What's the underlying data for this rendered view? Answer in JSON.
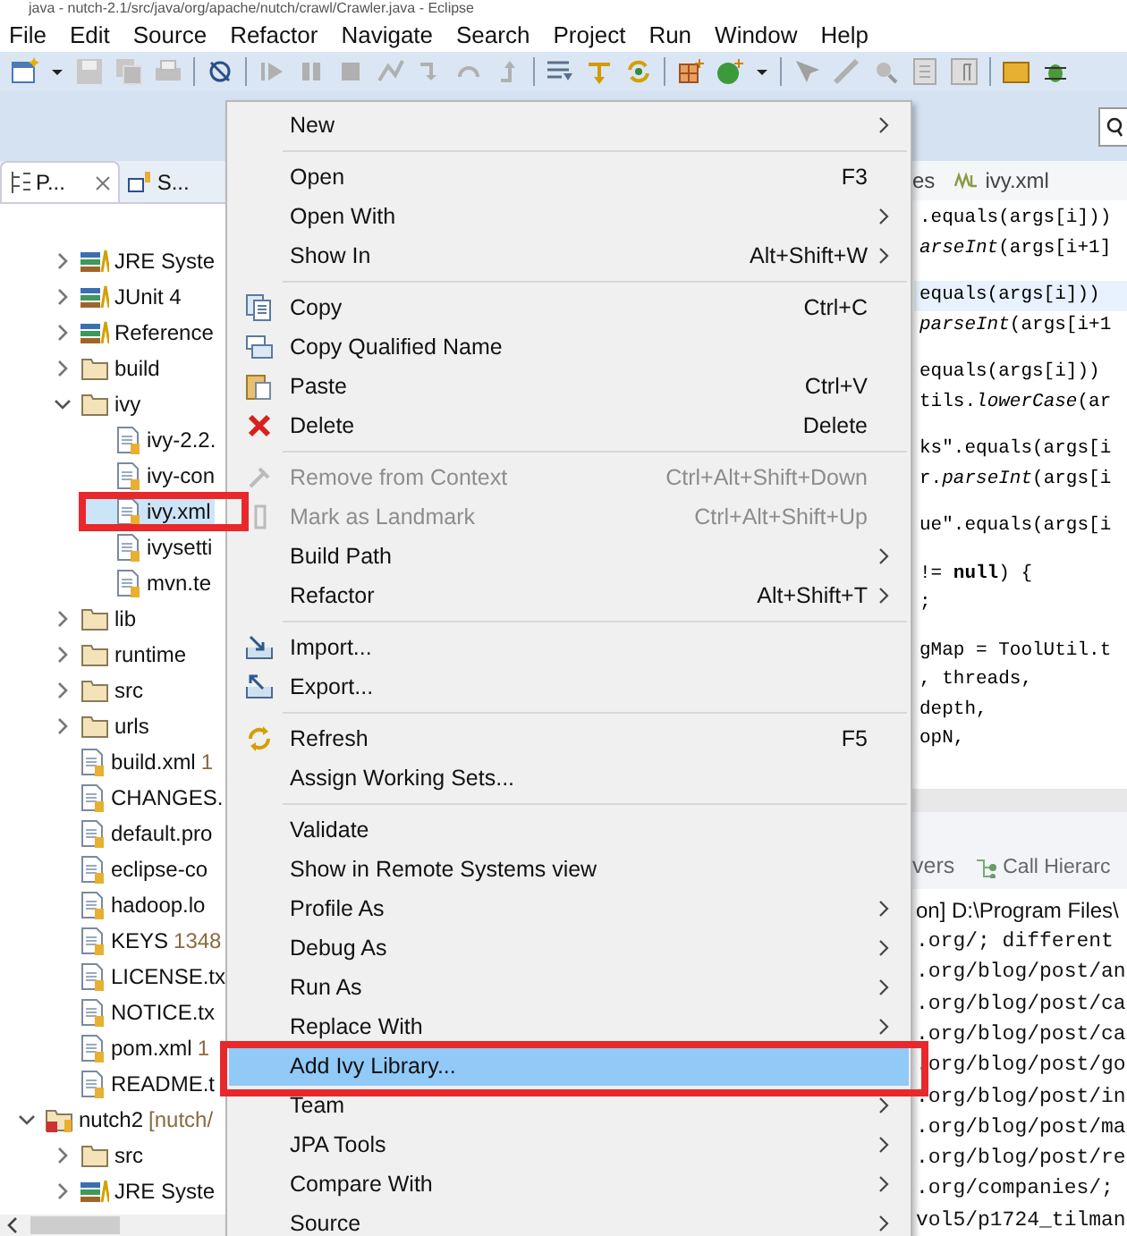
{
  "window": {
    "title": "java - nutch-2.1/src/java/org/apache/nutch/crawl/Crawler.java - Eclipse"
  },
  "menu_bar": [
    "File",
    "Edit",
    "Source",
    "Refactor",
    "Navigate",
    "Search",
    "Project",
    "Run",
    "Window",
    "Help"
  ],
  "explorer": {
    "tabs": [
      {
        "label": "P...",
        "selected": true
      },
      {
        "label": "S...",
        "selected": false
      }
    ],
    "tree": {
      "continued": [
        {
          "label": "JRE Syste",
          "kind": "library",
          "expanded": false,
          "selected": false
        },
        {
          "label": "JUnit 4",
          "kind": "library",
          "expanded": false,
          "selected": false
        },
        {
          "label": "Reference",
          "kind": "library",
          "expanded": false,
          "selected": false
        },
        {
          "label": "build",
          "kind": "folder",
          "expanded": false,
          "selected": false
        },
        {
          "label": "ivy",
          "kind": "folder",
          "expanded": true,
          "selected": false,
          "children": [
            {
              "label": "ivy-2.2.",
              "kind": "file",
              "selected": false
            },
            {
              "label": "ivy-con",
              "kind": "file",
              "selected": false
            },
            {
              "label": "ivy.xml",
              "kind": "file",
              "selected": true
            },
            {
              "label": "ivysetti",
              "kind": "file",
              "selected": false
            },
            {
              "label": "mvn.te",
              "kind": "file",
              "selected": false
            }
          ]
        },
        {
          "label": "lib",
          "kind": "folder",
          "expanded": false,
          "selected": false
        },
        {
          "label": "runtime",
          "kind": "folder",
          "expanded": false,
          "selected": false
        },
        {
          "label": "src",
          "kind": "folder",
          "expanded": false,
          "selected": false
        },
        {
          "label": "urls",
          "kind": "folder",
          "expanded": false,
          "selected": false
        },
        {
          "label": "build.xml",
          "decoration": "1",
          "kind": "file",
          "selected": false
        },
        {
          "label": "CHANGES.",
          "kind": "file",
          "selected": false
        },
        {
          "label": "default.pro",
          "kind": "file",
          "selected": false
        },
        {
          "label": "eclipse-co",
          "kind": "file",
          "selected": false
        },
        {
          "label": "hadoop.lo",
          "kind": "file",
          "selected": false
        },
        {
          "label": "KEYS",
          "decoration": "1348",
          "kind": "file",
          "selected": false
        },
        {
          "label": "LICENSE.tx",
          "kind": "file",
          "selected": false
        },
        {
          "label": "NOTICE.tx",
          "kind": "file",
          "selected": false
        },
        {
          "label": "pom.xml",
          "decoration": "1",
          "kind": "file",
          "selected": false
        },
        {
          "label": "README.t",
          "kind": "file",
          "selected": false
        }
      ],
      "projects": [
        {
          "label": "nutch2",
          "decoration": "[nutch/",
          "kind": "project",
          "expanded": true,
          "selected": false,
          "children": [
            {
              "label": "src",
              "kind": "folder",
              "expanded": false,
              "selected": false
            },
            {
              "label": "JRE Syste",
              "kind": "library",
              "expanded": false,
              "selected": false
            }
          ]
        }
      ]
    }
  },
  "editor": {
    "tabs": [
      "es",
      "ivy.xml"
    ],
    "groups": [
      [
        {
          "text": ".equals(args[i]))",
          "current": false
        },
        {
          "text": "*arseInt*(args[i+1]",
          "current": false
        }
      ],
      [
        {
          "text": "equals(args[i]))",
          "current": true
        },
        {
          "text": "*parseInt*(args[i+1",
          "current": false
        }
      ],
      [
        {
          "text": "equals(args[i]))",
          "current": false
        },
        {
          "text": "tils.*lowerCase*(ar",
          "current": false
        }
      ],
      [
        {
          "text": "ks\".equals(args[i",
          "current": false
        },
        {
          "text": "r.*parseInt*(args[i",
          "current": false
        }
      ],
      [
        {
          "text": "ue\".equals(args[i",
          "current": false
        }
      ],
      [
        {
          "text": "!= **null**) {",
          "current": false
        },
        {
          "text": ";",
          "current": false
        }
      ],
      [
        {
          "text": "gMap = ToolUtil.t",
          "current": false
        },
        {
          "text": ", threads,",
          "current": false
        },
        {
          "text": "depth,",
          "current": false
        },
        {
          "text": "opN,",
          "current": false
        }
      ]
    ]
  },
  "console": {
    "tabs": [
      "vers",
      "Call Hierarc"
    ],
    "lines": [
      "on] D:\\Program Files\\",
      ".org/; different",
      ".org/blog/post/an",
      ".org/blog/post/ca",
      ".org/blog/post/ca",
      ".org/blog/post/go",
      ".org/blog/post/in",
      ".org/blog/post/ma",
      ".org/blog/post/re",
      ".org/companies/;",
      "vol5/p1724_tilman"
    ]
  },
  "context_menu": {
    "groups": [
      [
        {
          "label": "New",
          "submenu": true,
          "disabled": false,
          "selected": false
        }
      ],
      [
        {
          "label": "Open",
          "shortcut": "F3",
          "submenu": false,
          "disabled": false,
          "selected": false
        },
        {
          "label": "Open With",
          "submenu": true,
          "disabled": false,
          "selected": false
        },
        {
          "label": "Show In",
          "shortcut": "Alt+Shift+W",
          "submenu": true,
          "disabled": false,
          "selected": false
        }
      ],
      [
        {
          "label": "Copy",
          "shortcut": "Ctrl+C",
          "submenu": false,
          "disabled": false,
          "selected": false
        },
        {
          "label": "Copy Qualified Name",
          "submenu": false,
          "disabled": false,
          "selected": false
        },
        {
          "label": "Paste",
          "shortcut": "Ctrl+V",
          "submenu": false,
          "disabled": false,
          "selected": false
        },
        {
          "label": "Delete",
          "shortcut": "Delete",
          "submenu": false,
          "disabled": false,
          "selected": false
        }
      ],
      [
        {
          "label": "Remove from Context",
          "shortcut": "Ctrl+Alt+Shift+Down",
          "submenu": false,
          "disabled": true,
          "selected": false
        },
        {
          "label": "Mark as Landmark",
          "shortcut": "Ctrl+Alt+Shift+Up",
          "submenu": false,
          "disabled": true,
          "selected": false
        },
        {
          "label": "Build Path",
          "submenu": true,
          "disabled": false,
          "selected": false
        },
        {
          "label": "Refactor",
          "shortcut": "Alt+Shift+T",
          "submenu": true,
          "disabled": false,
          "selected": false
        }
      ],
      [
        {
          "label": "Import...",
          "submenu": false,
          "disabled": false,
          "selected": false
        },
        {
          "label": "Export...",
          "submenu": false,
          "disabled": false,
          "selected": false
        }
      ],
      [
        {
          "label": "Refresh",
          "shortcut": "F5",
          "submenu": false,
          "disabled": false,
          "selected": false
        },
        {
          "label": "Assign Working Sets...",
          "submenu": false,
          "disabled": false,
          "selected": false
        }
      ],
      [
        {
          "label": "Validate",
          "submenu": false,
          "disabled": false,
          "selected": false
        },
        {
          "label": "Show in Remote Systems view",
          "submenu": false,
          "disabled": false,
          "selected": false
        },
        {
          "label": "Profile As",
          "submenu": true,
          "disabled": false,
          "selected": false
        },
        {
          "label": "Debug As",
          "submenu": true,
          "disabled": false,
          "selected": false
        },
        {
          "label": "Run As",
          "submenu": true,
          "disabled": false,
          "selected": false
        },
        {
          "label": "Replace With",
          "submenu": true,
          "disabled": false,
          "selected": false
        },
        {
          "label": "Add Ivy Library...",
          "submenu": false,
          "disabled": false,
          "selected": true
        },
        {
          "label": "Team",
          "submenu": true,
          "disabled": false,
          "selected": false
        },
        {
          "label": "JPA Tools",
          "submenu": true,
          "disabled": false,
          "selected": false
        },
        {
          "label": "Compare With",
          "submenu": true,
          "disabled": false,
          "selected": false
        },
        {
          "label": "Source",
          "submenu": true,
          "disabled": false,
          "selected": false
        }
      ]
    ]
  }
}
